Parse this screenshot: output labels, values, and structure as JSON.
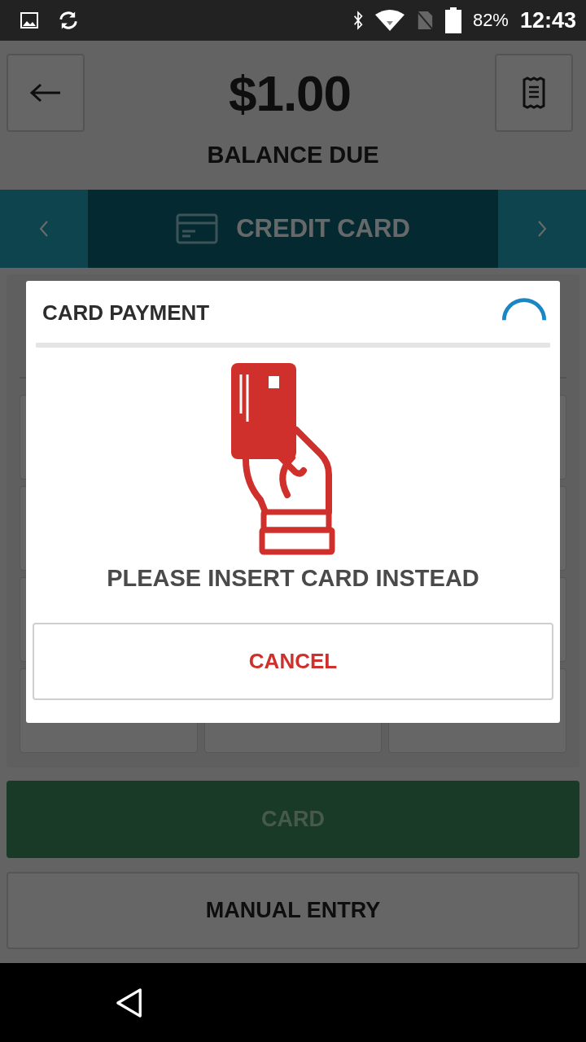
{
  "status_bar": {
    "battery": "82%",
    "time": "12:43"
  },
  "header": {
    "amount": "$1.00",
    "label": "BALANCE DUE"
  },
  "payment_tabs": {
    "current": "CREDIT CARD"
  },
  "dialog": {
    "title": "CARD PAYMENT",
    "loading": true,
    "message": "PLEASE INSERT CARD INSTEAD",
    "cancel": "CANCEL"
  },
  "buttons": [
    {
      "label": "CARD",
      "kind": "primary"
    },
    {
      "label": "MANUAL ENTRY",
      "kind": "secondary"
    }
  ]
}
